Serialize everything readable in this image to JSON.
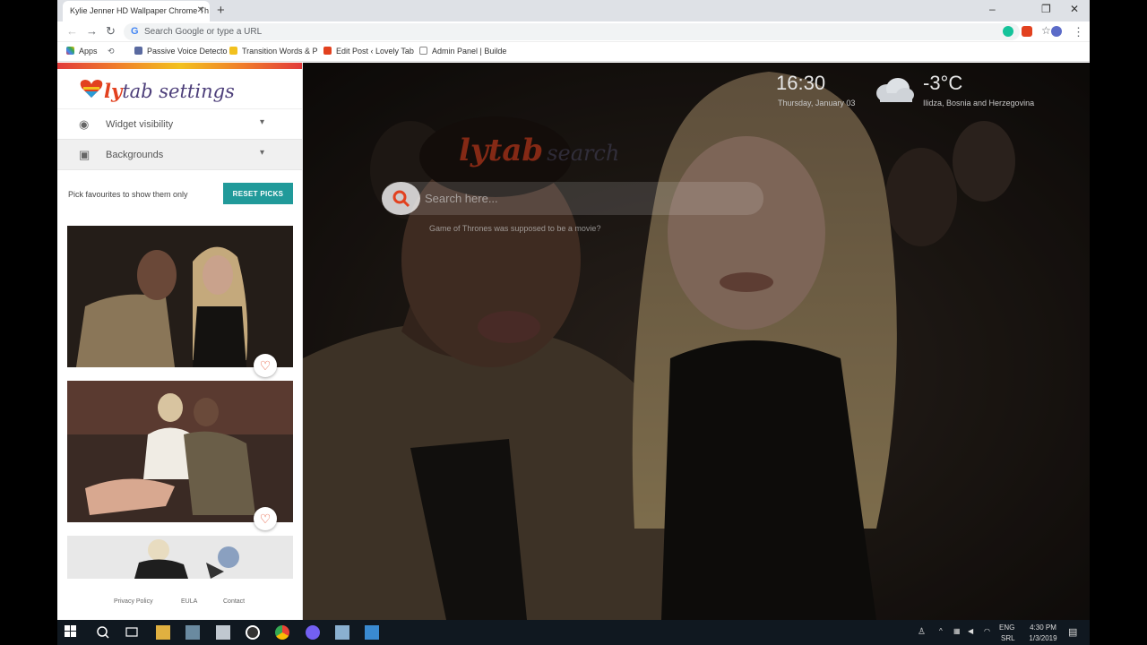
{
  "browser": {
    "tab_title": "Kylie Jenner HD Wallpaper Chrome Th",
    "tab_close": "✕",
    "new_tab": "+",
    "win_min": "–",
    "win_restore": "❐",
    "win_close": "✕",
    "omnibox_placeholder": "Search Google or type a URL",
    "bookmarks": [
      "Apps",
      "Passive Voice Detecto",
      "Transition Words & P",
      "Edit Post ‹ Lovely Tab",
      "Admin Panel | Builde"
    ]
  },
  "settings": {
    "logo_ly": "ly",
    "logo_rest": "tab settings",
    "accordion": [
      {
        "label": "Widget visibility",
        "icon": "eye-icon"
      },
      {
        "label": "Backgrounds",
        "icon": "camera-icon"
      }
    ],
    "pick_text": "Pick favourites to show them only",
    "reset_label": "RESET PICKS",
    "footer": [
      "Privacy Policy",
      "EULA",
      "Contact"
    ]
  },
  "widgets": {
    "time": "16:30",
    "date": "Thursday, January 03",
    "temperature": "-3°C",
    "location": "Ilidza, Bosnia and Herzegovina",
    "search_logo": "lytab",
    "search_logo_suffix": "search",
    "search_placeholder": "Search here...",
    "suggestion": "Game of Thrones was supposed to be a movie?"
  },
  "taskbar": {
    "lang_1": "ENG",
    "lang_2": "SRL",
    "time": "4:30 PM",
    "date": "1/3/2019"
  },
  "colors": {
    "accent_teal": "#219a9a",
    "brand_red": "#e2411f",
    "brand_purple": "#4d3f7a"
  }
}
